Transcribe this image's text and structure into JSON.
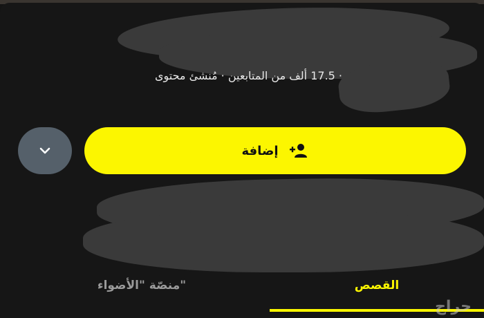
{
  "profile": {
    "stats": "· 17.5 ألف من المتابعين · مُنشئ محتوى"
  },
  "actions": {
    "add_label": "إضافة",
    "add_icon": "add-user-icon",
    "more_icon": "chevron-down-icon"
  },
  "tabs": {
    "stories_label": "القصص",
    "spotlight_label": "منصّة \"الأضواء\""
  },
  "watermark": "حراج",
  "colors": {
    "accent": "#fcf600",
    "background": "#161616",
    "secondary_button": "#55606a"
  }
}
